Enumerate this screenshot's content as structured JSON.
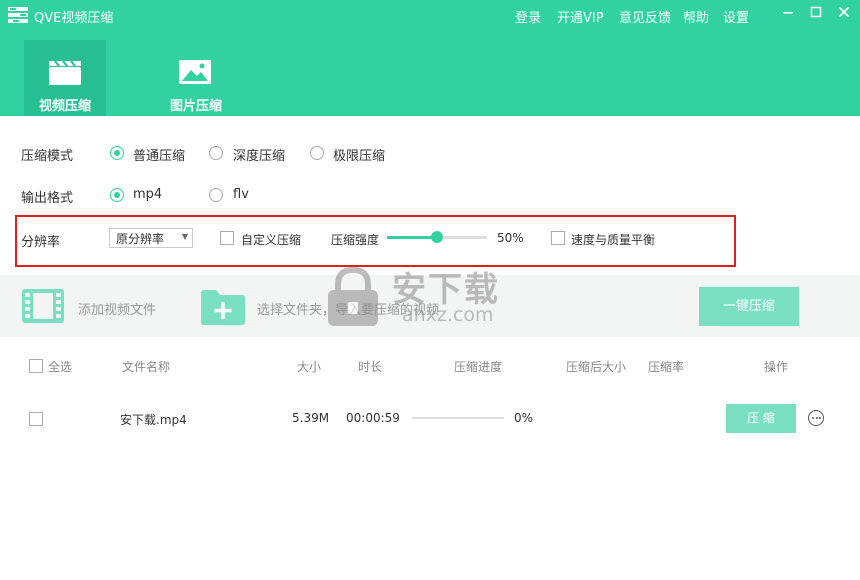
{
  "app": {
    "title": "QVE视频压缩"
  },
  "menu": {
    "login": "登录",
    "vip": "开通VIP",
    "feedback": "意见反馈",
    "help": "帮助",
    "settings": "设置"
  },
  "tabs": [
    {
      "label": "视频压缩",
      "icon": "clapperboard-icon",
      "active": true
    },
    {
      "label": "图片压缩",
      "icon": "image-icon",
      "active": false
    }
  ],
  "settings": {
    "mode": {
      "label": "压缩模式",
      "options": [
        "普通压缩",
        "深度压缩",
        "极限压缩"
      ],
      "selected": "普通压缩"
    },
    "format": {
      "label": "输出格式",
      "options": [
        "mp4",
        "flv"
      ],
      "selected": "mp4"
    },
    "resolution": {
      "label": "分辨率",
      "value": "原分辨率"
    },
    "custom": {
      "label": "自定义压缩"
    },
    "strength": {
      "label": "压缩强度",
      "value_text": "50%",
      "value": 0.5
    },
    "balance": {
      "label": "速度与质量平衡"
    }
  },
  "actions": {
    "add_video": "添加视频文件",
    "select_folder": "选择文件夹，导入要压缩的视频",
    "one_key": "一键压缩"
  },
  "table": {
    "headers": {
      "select_all": "全选",
      "name": "文件名称",
      "size": "大小",
      "duration": "时长",
      "progress": "压缩进度",
      "after_size": "压缩后大小",
      "ratio": "压缩率",
      "ops": "操作"
    },
    "rows": [
      {
        "name": "安下载.mp4",
        "size": "5.39M",
        "duration": "00:00:59",
        "progress_text": "0%",
        "progress": 0,
        "action": "压 缩"
      }
    ]
  },
  "watermark": {
    "text": "安下载",
    "subtext": "anxz.com"
  },
  "colors": {
    "accent": "#32d2a0",
    "accent_dark": "#28c092",
    "button_light": "#7adfc0",
    "highlight": "#e02020"
  }
}
